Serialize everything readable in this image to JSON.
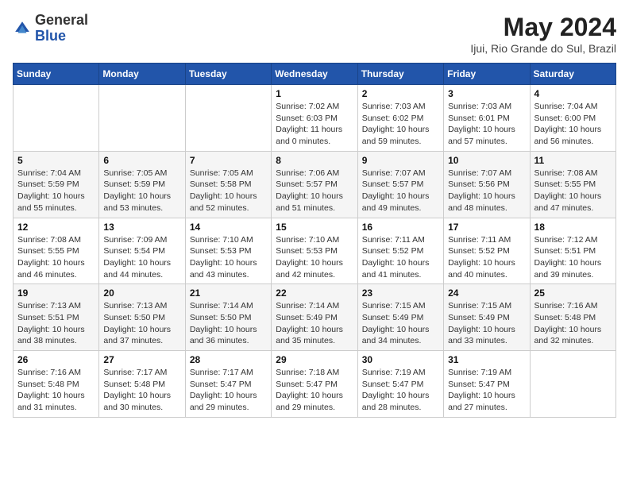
{
  "logo": {
    "general": "General",
    "blue": "Blue"
  },
  "title": "May 2024",
  "location": "Ijui, Rio Grande do Sul, Brazil",
  "days_of_week": [
    "Sunday",
    "Monday",
    "Tuesday",
    "Wednesday",
    "Thursday",
    "Friday",
    "Saturday"
  ],
  "weeks": [
    [
      null,
      null,
      null,
      {
        "day": "1",
        "sunrise": "7:02 AM",
        "sunset": "6:03 PM",
        "daylight": "11 hours and 0 minutes."
      },
      {
        "day": "2",
        "sunrise": "7:03 AM",
        "sunset": "6:02 PM",
        "daylight": "10 hours and 59 minutes."
      },
      {
        "day": "3",
        "sunrise": "7:03 AM",
        "sunset": "6:01 PM",
        "daylight": "10 hours and 57 minutes."
      },
      {
        "day": "4",
        "sunrise": "7:04 AM",
        "sunset": "6:00 PM",
        "daylight": "10 hours and 56 minutes."
      }
    ],
    [
      {
        "day": "5",
        "sunrise": "7:04 AM",
        "sunset": "5:59 PM",
        "daylight": "10 hours and 55 minutes."
      },
      {
        "day": "6",
        "sunrise": "7:05 AM",
        "sunset": "5:59 PM",
        "daylight": "10 hours and 53 minutes."
      },
      {
        "day": "7",
        "sunrise": "7:05 AM",
        "sunset": "5:58 PM",
        "daylight": "10 hours and 52 minutes."
      },
      {
        "day": "8",
        "sunrise": "7:06 AM",
        "sunset": "5:57 PM",
        "daylight": "10 hours and 51 minutes."
      },
      {
        "day": "9",
        "sunrise": "7:07 AM",
        "sunset": "5:57 PM",
        "daylight": "10 hours and 49 minutes."
      },
      {
        "day": "10",
        "sunrise": "7:07 AM",
        "sunset": "5:56 PM",
        "daylight": "10 hours and 48 minutes."
      },
      {
        "day": "11",
        "sunrise": "7:08 AM",
        "sunset": "5:55 PM",
        "daylight": "10 hours and 47 minutes."
      }
    ],
    [
      {
        "day": "12",
        "sunrise": "7:08 AM",
        "sunset": "5:55 PM",
        "daylight": "10 hours and 46 minutes."
      },
      {
        "day": "13",
        "sunrise": "7:09 AM",
        "sunset": "5:54 PM",
        "daylight": "10 hours and 44 minutes."
      },
      {
        "day": "14",
        "sunrise": "7:10 AM",
        "sunset": "5:53 PM",
        "daylight": "10 hours and 43 minutes."
      },
      {
        "day": "15",
        "sunrise": "7:10 AM",
        "sunset": "5:53 PM",
        "daylight": "10 hours and 42 minutes."
      },
      {
        "day": "16",
        "sunrise": "7:11 AM",
        "sunset": "5:52 PM",
        "daylight": "10 hours and 41 minutes."
      },
      {
        "day": "17",
        "sunrise": "7:11 AM",
        "sunset": "5:52 PM",
        "daylight": "10 hours and 40 minutes."
      },
      {
        "day": "18",
        "sunrise": "7:12 AM",
        "sunset": "5:51 PM",
        "daylight": "10 hours and 39 minutes."
      }
    ],
    [
      {
        "day": "19",
        "sunrise": "7:13 AM",
        "sunset": "5:51 PM",
        "daylight": "10 hours and 38 minutes."
      },
      {
        "day": "20",
        "sunrise": "7:13 AM",
        "sunset": "5:50 PM",
        "daylight": "10 hours and 37 minutes."
      },
      {
        "day": "21",
        "sunrise": "7:14 AM",
        "sunset": "5:50 PM",
        "daylight": "10 hours and 36 minutes."
      },
      {
        "day": "22",
        "sunrise": "7:14 AM",
        "sunset": "5:49 PM",
        "daylight": "10 hours and 35 minutes."
      },
      {
        "day": "23",
        "sunrise": "7:15 AM",
        "sunset": "5:49 PM",
        "daylight": "10 hours and 34 minutes."
      },
      {
        "day": "24",
        "sunrise": "7:15 AM",
        "sunset": "5:49 PM",
        "daylight": "10 hours and 33 minutes."
      },
      {
        "day": "25",
        "sunrise": "7:16 AM",
        "sunset": "5:48 PM",
        "daylight": "10 hours and 32 minutes."
      }
    ],
    [
      {
        "day": "26",
        "sunrise": "7:16 AM",
        "sunset": "5:48 PM",
        "daylight": "10 hours and 31 minutes."
      },
      {
        "day": "27",
        "sunrise": "7:17 AM",
        "sunset": "5:48 PM",
        "daylight": "10 hours and 30 minutes."
      },
      {
        "day": "28",
        "sunrise": "7:17 AM",
        "sunset": "5:47 PM",
        "daylight": "10 hours and 29 minutes."
      },
      {
        "day": "29",
        "sunrise": "7:18 AM",
        "sunset": "5:47 PM",
        "daylight": "10 hours and 29 minutes."
      },
      {
        "day": "30",
        "sunrise": "7:19 AM",
        "sunset": "5:47 PM",
        "daylight": "10 hours and 28 minutes."
      },
      {
        "day": "31",
        "sunrise": "7:19 AM",
        "sunset": "5:47 PM",
        "daylight": "10 hours and 27 minutes."
      },
      null
    ]
  ],
  "labels": {
    "sunrise": "Sunrise:",
    "sunset": "Sunset:",
    "daylight": "Daylight hours"
  }
}
